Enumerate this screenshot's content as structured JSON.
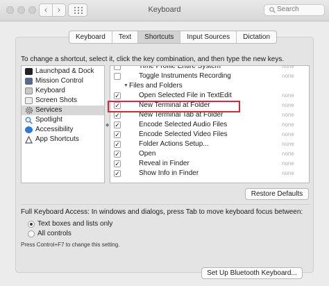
{
  "window": {
    "title": "Keyboard",
    "nav_back": "‹",
    "nav_forward": "›"
  },
  "search": {
    "placeholder": "Search"
  },
  "tabs": [
    {
      "label": "Keyboard",
      "active": false
    },
    {
      "label": "Text",
      "active": false
    },
    {
      "label": "Shortcuts",
      "active": true
    },
    {
      "label": "Input Sources",
      "active": false
    },
    {
      "label": "Dictation",
      "active": false
    }
  ],
  "instructions": "To change a shortcut, select it, click the key combination, and then type the new keys.",
  "categories": [
    {
      "label": "Launchpad & Dock",
      "icon": "launchpad-icon",
      "color": "#222222",
      "selected": false
    },
    {
      "label": "Mission Control",
      "icon": "mission-control-icon",
      "color": "#5a6b8a",
      "selected": false
    },
    {
      "label": "Keyboard",
      "icon": "keyboard-icon",
      "color": "#9a9a9a",
      "selected": false
    },
    {
      "label": "Screen Shots",
      "icon": "screenshot-icon",
      "color": "#e8e8e8",
      "selected": false
    },
    {
      "label": "Services",
      "icon": "services-gear-icon",
      "color": "#7a7a7a",
      "selected": true
    },
    {
      "label": "Spotlight",
      "icon": "spotlight-icon",
      "color": "#3b8be0",
      "selected": false
    },
    {
      "label": "Accessibility",
      "icon": "accessibility-icon",
      "color": "#2d7bd8",
      "selected": false
    },
    {
      "label": "App Shortcuts",
      "icon": "app-shortcuts-icon",
      "color": "#6a6a6a",
      "selected": false
    }
  ],
  "shortcuts": [
    {
      "label": "Time Profile Entire System",
      "checked": false,
      "key": "none",
      "group": false
    },
    {
      "label": "Toggle Instruments Recording",
      "checked": false,
      "key": "none",
      "group": false
    },
    {
      "label": "Files and Folders",
      "checked": null,
      "key": "",
      "group": true,
      "triangle": "▼"
    },
    {
      "label": "Open Selected File in TextEdit",
      "checked": true,
      "key": "none",
      "group": false
    },
    {
      "label": "New Terminal at Folder",
      "checked": true,
      "key": "none",
      "group": false
    },
    {
      "label": "New Terminal Tab at Folder",
      "checked": true,
      "key": "none",
      "group": false
    },
    {
      "label": "Encode Selected Audio Files",
      "checked": true,
      "key": "none",
      "group": false
    },
    {
      "label": "Encode Selected Video Files",
      "checked": true,
      "key": "none",
      "group": false
    },
    {
      "label": "Folder Actions Setup...",
      "checked": true,
      "key": "none",
      "group": false
    },
    {
      "label": "Open",
      "checked": true,
      "key": "none",
      "group": false
    },
    {
      "label": "Reveal in Finder",
      "checked": true,
      "key": "none",
      "group": false
    },
    {
      "label": "Show Info in Finder",
      "checked": true,
      "key": "none",
      "group": false
    }
  ],
  "highlight_color": "#d8253b",
  "restore_button": "Restore Defaults",
  "full_keyboard_access": {
    "label": "Full Keyboard Access: In windows and dialogs, press Tab to move keyboard focus between:",
    "options": [
      {
        "label": "Text boxes and lists only",
        "selected": true
      },
      {
        "label": "All controls",
        "selected": false
      }
    ],
    "hint": "Press Control+F7 to change this setting."
  },
  "bluetooth_button": "Set Up Bluetooth Keyboard..."
}
